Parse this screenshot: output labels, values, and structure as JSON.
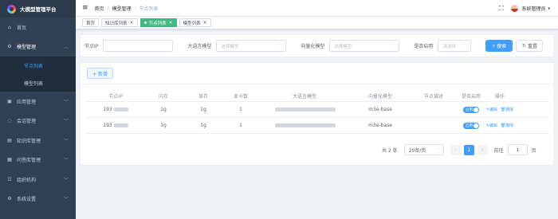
{
  "app": {
    "title": "大模型管理平台"
  },
  "sidebar": {
    "items": [
      {
        "label": "首页",
        "icon": "home-icon"
      },
      {
        "label": "模型管理",
        "icon": "model-icon",
        "open": true,
        "children": [
          {
            "label": "节点列表",
            "active": true
          },
          {
            "label": "模型列表"
          }
        ]
      },
      {
        "label": "应用管理",
        "icon": "app-icon"
      },
      {
        "label": "会话管理",
        "icon": "chat-icon"
      },
      {
        "label": "知识库管理",
        "icon": "knowledge-icon"
      },
      {
        "label": "问答库管理",
        "icon": "qa-icon"
      },
      {
        "label": "组织机构",
        "icon": "org-icon"
      },
      {
        "label": "系统设置",
        "icon": "settings-icon"
      }
    ]
  },
  "header": {
    "breadcrumb": [
      "首页",
      "模型管理",
      "节点列表"
    ],
    "user": "系统管理员"
  },
  "tags": [
    {
      "label": "首页",
      "active": false,
      "closable": false
    },
    {
      "label": "知识库列表",
      "active": false,
      "closable": true
    },
    {
      "label": "节点列表",
      "active": true,
      "closable": true
    },
    {
      "label": "模型列表",
      "active": false,
      "closable": true
    }
  ],
  "search": {
    "node_ip_label": "节点IP",
    "node_ip_value": "",
    "llm_label": "大语言模型",
    "llm_placeholder": "选择模型",
    "vector_label": "向量化模型",
    "vector_placeholder": "选择模型",
    "enabled_label": "是否启用",
    "enabled_placeholder": "请选择",
    "search_button": "搜索",
    "reset_button": "重置"
  },
  "table": {
    "add_button": "+ 新增",
    "columns": [
      "节点IP",
      "内存",
      "显存",
      "显卡数",
      "大语言模型",
      "向量化模型",
      "节点描述",
      "是否启用",
      "操作"
    ],
    "rows": [
      {
        "ip": "193",
        "memory": "1g",
        "vram": "1g",
        "gpu_count": "1",
        "llm": "",
        "vector_model": "m3e-base",
        "desc": "",
        "enabled": "启用",
        "edit": "编辑",
        "delete": "删除"
      },
      {
        "ip": "193",
        "memory": "1g",
        "vram": "1g",
        "gpu_count": "1",
        "llm": "",
        "vector_model": "m3e-base",
        "desc": "",
        "enabled": "启用",
        "edit": "编辑",
        "delete": "删除"
      }
    ]
  },
  "pagination": {
    "total": "共 2 条",
    "page_size": "20条/页",
    "current": "1",
    "goto_label": "前往",
    "goto_value": "1",
    "page_unit": "页"
  },
  "colors": {
    "sidebar_bg": "#304156",
    "primary": "#409eff",
    "active_tag": "#42b983"
  }
}
